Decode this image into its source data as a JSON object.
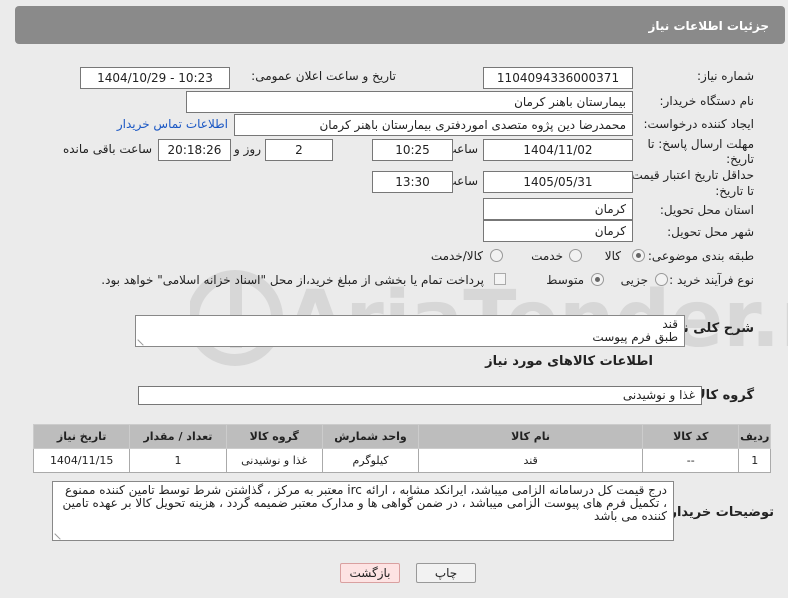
{
  "header": {
    "title": "جزئیات اطلاعات نیاز"
  },
  "form": {
    "need_number": {
      "label": "شماره نیاز:",
      "value": "1104094336000371"
    },
    "announce": {
      "label": "تاریخ و ساعت اعلان عمومی:",
      "value": "1404/10/29 - 10:23"
    },
    "buyer_org": {
      "label": "نام دستگاه خریدار:",
      "value": "بیمارستان باهنر کرمان"
    },
    "creator": {
      "label": "ایجاد کننده درخواست:",
      "value": "محمدرضا  دین پژوه متصدی اموردفتری بیمارستان باهنر کرمان",
      "contact_link": "اطلاعات تماس خریدار"
    },
    "reply_deadline": {
      "label_line1": "مهلت ارسال پاسخ: تا",
      "label_line2": "تاریخ:",
      "date": "1404/11/02",
      "time_label": "ساعت",
      "time": "10:25",
      "days": "2",
      "days_label": "روز و",
      "remaining": "20:18:26",
      "remaining_label": "ساعت باقی مانده"
    },
    "price_validity": {
      "label_line1": "حداقل تاریخ اعتبار قیمت:",
      "label_line2": "تا تاریخ:",
      "date": "1405/05/31",
      "time_label": "ساعت",
      "time": "13:30"
    },
    "province": {
      "label": "استان محل تحویل:",
      "value": "کرمان"
    },
    "city": {
      "label": "شهر محل تحویل:",
      "value": "کرمان"
    },
    "category": {
      "label": "طبقه بندی موضوعی:",
      "options": [
        "کالا",
        "خدمت",
        "کالا/خدمت"
      ],
      "selected": "کالا"
    },
    "purchase_type": {
      "label": "نوع فرآیند خرید :",
      "options": [
        "جزیی",
        "متوسط"
      ],
      "selected": "متوسط",
      "payment_note": "پرداخت تمام یا بخشی از مبلغ خرید،از محل \"اسناد خزانه اسلامی\" خواهد بود."
    }
  },
  "description": {
    "label": "شرح کلی نیاز:",
    "line1": "قند",
    "line2": "طبق فرم پیوست"
  },
  "goods_info": {
    "title": "اطلاعات کالاهای مورد نیاز"
  },
  "goods_group": {
    "label": "گروه کالا:",
    "value": "غذا و نوشیدنی"
  },
  "table": {
    "headers": [
      "ردیف",
      "کد کالا",
      "نام کالا",
      "واحد شمارش",
      "گروه کالا",
      "تعداد / مقدار",
      "تاریخ نیاز"
    ],
    "rows": [
      [
        "1",
        "--",
        "قند",
        "کیلوگرم",
        "غذا و نوشیدنی",
        "1",
        "1404/11/15"
      ]
    ]
  },
  "buyer_notes": {
    "label": "توضیحات خریدار:",
    "text": "درج قیمت کل درسامانه الزامی میباشد، ایرانکد مشابه ، ارائه irc معتبر به مرکز ، گذاشتن شرط توسط تامین کننده ممنوع ، تکمیل فرم های پیوست الزامی میباشد ، در ضمن گواهی ها و مدارک معتبر ضمیمه گردد ، هزینه تحویل کالا بر عهده تامین کننده می باشد"
  },
  "buttons": {
    "print": "چاپ",
    "back": "بازگشت"
  },
  "watermark": {
    "text": "AriaTender.neT"
  },
  "colors": {
    "header": "#8a8a8a",
    "panel": "#ebebeb",
    "link": "#1a57c4",
    "table_header": "#bdbdbd"
  }
}
